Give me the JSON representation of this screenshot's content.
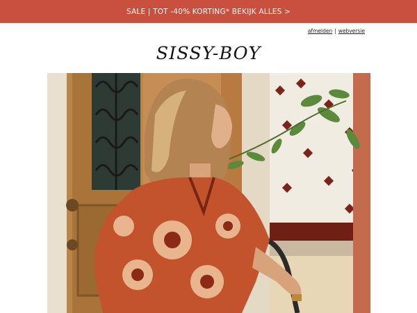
{
  "banner": {
    "text": "SALE | TOT -40% KORTING* BEKIJK ALLES >"
  },
  "top_links": {
    "unsubscribe": "afmelden",
    "separator": "|",
    "web_version": "webversie"
  },
  "brand": {
    "logo_text": "SISSY-BOY"
  },
  "hero": {
    "image_name": "hero-photo"
  },
  "colors": {
    "banner_bg": "#c9503f",
    "banner_text": "#ffffff",
    "page_bg": "#ffffff",
    "text": "#222222"
  }
}
